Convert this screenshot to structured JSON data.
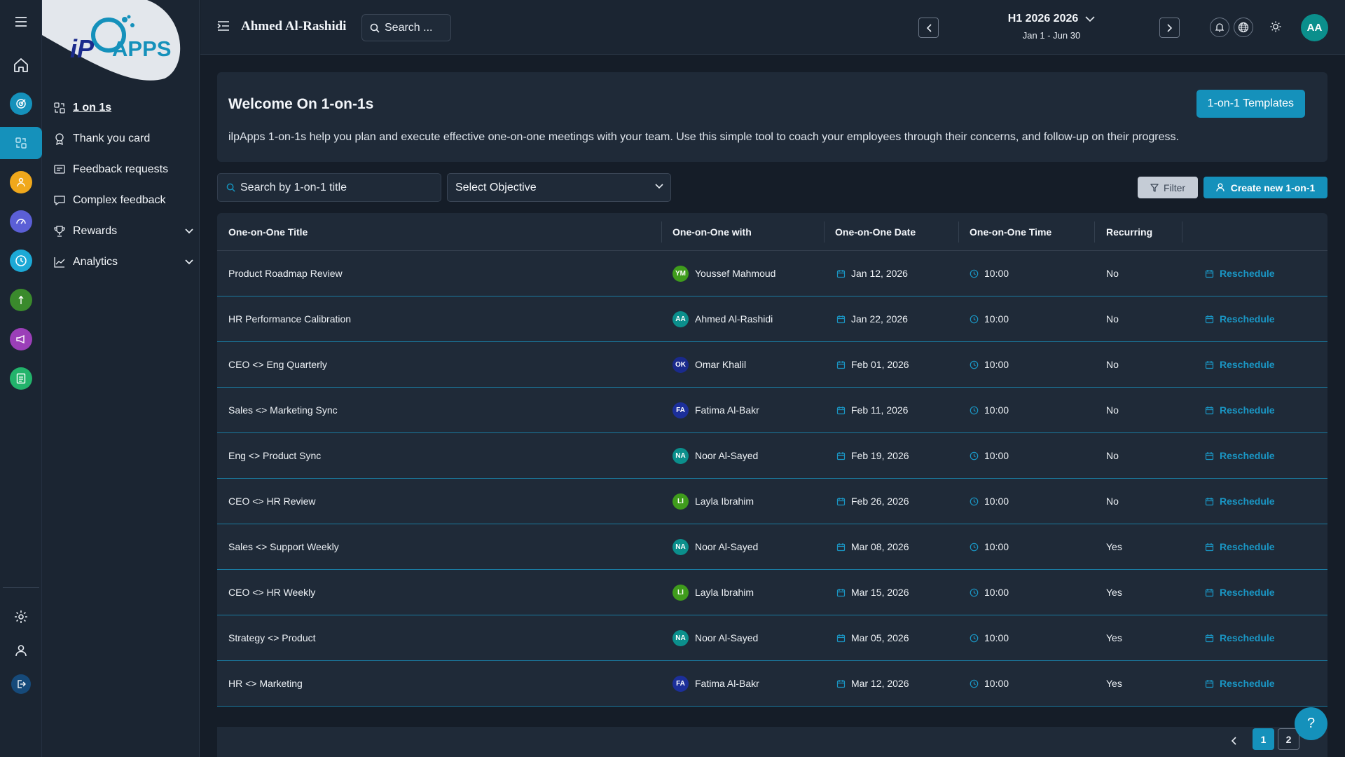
{
  "app": {
    "logo_text": "APPS"
  },
  "rail": {
    "icons": [
      {
        "name": "hamburger-icon"
      },
      {
        "name": "home-icon"
      },
      {
        "name": "target-icon",
        "color": "#1591bb"
      },
      {
        "name": "one-on-one-icon",
        "color": "#1591bb"
      },
      {
        "name": "people-icon",
        "color": "#f0a81c"
      },
      {
        "name": "gauge-icon",
        "color": "#5b5fd6"
      },
      {
        "name": "clock-icon",
        "color": "#1ca9d6"
      },
      {
        "name": "leaf-icon",
        "color": "#3a8a2c"
      },
      {
        "name": "megaphone-icon",
        "color": "#9b3fb8"
      },
      {
        "name": "survey-icon",
        "color": "#22b36b"
      },
      {
        "name": "gear-icon"
      },
      {
        "name": "user-icon"
      },
      {
        "name": "logout-icon",
        "color": "#164a7a"
      }
    ]
  },
  "nav": {
    "items": [
      {
        "label": "1 on 1s",
        "icon": "one-on-one-icon",
        "current": true
      },
      {
        "label": "Thank you card",
        "icon": "award-icon"
      },
      {
        "label": "Feedback requests",
        "icon": "feedback-request-icon"
      },
      {
        "label": "Complex feedback",
        "icon": "chat-icon"
      },
      {
        "label": "Rewards",
        "icon": "trophy-icon",
        "expandable": true
      },
      {
        "label": "Analytics",
        "icon": "chart-line-icon",
        "expandable": true
      }
    ]
  },
  "topbar": {
    "user_name": "Ahmed Al-Rashidi",
    "search_placeholder": "Search ...",
    "period_title": "H1 2026 2026",
    "period_range": "Jan 1 - Jun 30",
    "avatar_initials": "AA"
  },
  "welcome": {
    "title": "Welcome On 1-on-1s",
    "description": "ilpApps 1-on-1s help you plan and execute effective one-on-one meetings with your team. Use this simple tool to coach your employees through their concerns, and follow-up on their progress.",
    "templates_button": "1-on-1 Templates"
  },
  "filters": {
    "search_placeholder": "Search by 1-on-1 title",
    "objective_select": "Select Objective",
    "filter_button": "Filter",
    "create_button": "Create new 1-on-1"
  },
  "table": {
    "headers": [
      "One-on-One Title",
      "One-on-One with",
      "One-on-One Date",
      "One-on-One Time",
      "Recurring"
    ],
    "action_label": "Reschedule",
    "rows": [
      {
        "title": "Product Roadmap Review",
        "initials": "YM",
        "avatar_color": "#3f9c1c",
        "with": "Youssef Mahmoud",
        "date": "Jan 12, 2026",
        "time": "10:00",
        "recurring": "No"
      },
      {
        "title": "HR Performance Calibration",
        "initials": "AA",
        "avatar_color": "#0b8f8c",
        "with": "Ahmed Al-Rashidi",
        "date": "Jan 22, 2026",
        "time": "10:00",
        "recurring": "No"
      },
      {
        "title": "CEO <> Eng Quarterly",
        "initials": "OK",
        "avatar_color": "#1a2a8c",
        "with": "Omar Khalil",
        "date": "Feb 01, 2026",
        "time": "10:00",
        "recurring": "No"
      },
      {
        "title": "Sales <> Marketing Sync",
        "initials": "FA",
        "avatar_color": "#1c2f9a",
        "with": "Fatima Al-Bakr",
        "date": "Feb 11, 2026",
        "time": "10:00",
        "recurring": "No"
      },
      {
        "title": "Eng <> Product Sync",
        "initials": "NA",
        "avatar_color": "#0b8f8c",
        "with": "Noor Al-Sayed",
        "date": "Feb 19, 2026",
        "time": "10:00",
        "recurring": "No"
      },
      {
        "title": "CEO <> HR Review",
        "initials": "LI",
        "avatar_color": "#3f9c1c",
        "with": "Layla Ibrahim",
        "date": "Feb 26, 2026",
        "time": "10:00",
        "recurring": "No"
      },
      {
        "title": "Sales <> Support Weekly",
        "initials": "NA",
        "avatar_color": "#0b8f8c",
        "with": "Noor Al-Sayed",
        "date": "Mar 08, 2026",
        "time": "10:00",
        "recurring": "Yes"
      },
      {
        "title": "CEO <> HR Weekly",
        "initials": "LI",
        "avatar_color": "#3f9c1c",
        "with": "Layla Ibrahim",
        "date": "Mar 15, 2026",
        "time": "10:00",
        "recurring": "Yes"
      },
      {
        "title": "Strategy <> Product",
        "initials": "NA",
        "avatar_color": "#0b8f8c",
        "with": "Noor Al-Sayed",
        "date": "Mar 05, 2026",
        "time": "10:00",
        "recurring": "Yes"
      },
      {
        "title": "HR <> Marketing",
        "initials": "FA",
        "avatar_color": "#1c2f9a",
        "with": "Fatima Al-Bakr",
        "date": "Mar 12, 2026",
        "time": "10:00",
        "recurring": "Yes"
      }
    ]
  },
  "pagination": {
    "pages": [
      "1",
      "2"
    ],
    "current": "1",
    "help": "?"
  },
  "colors": {
    "accent": "#1591bb",
    "background": "#151d28",
    "panel": "#1f2a38"
  }
}
